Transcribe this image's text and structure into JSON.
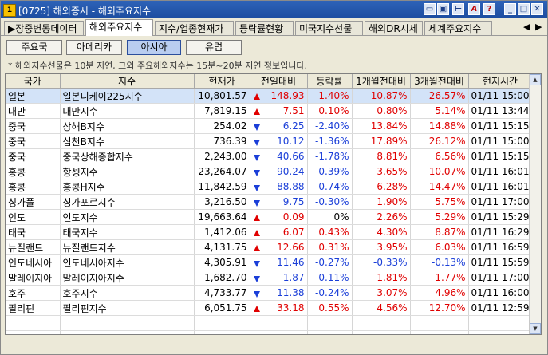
{
  "window": {
    "code": "[0725]",
    "title": "해외증시 - 해외주요지수",
    "app_icon": "1",
    "buttons": [
      "window-icon",
      "window2-icon",
      "pin-icon",
      "font-icon",
      "help-icon",
      "minimize-icon",
      "maximize-icon",
      "close-icon"
    ],
    "help_label": "?",
    "font_label": "A"
  },
  "tabs": [
    {
      "label": "▶장중변동데이터",
      "active": false
    },
    {
      "label": "해외주요지수",
      "active": true
    },
    {
      "label": "지수/업종현재가",
      "active": false
    },
    {
      "label": "등락률현황",
      "active": false
    },
    {
      "label": "미국지수선물",
      "active": false
    },
    {
      "label": "해외DR시세",
      "active": false
    },
    {
      "label": "세계주요지수",
      "active": false
    }
  ],
  "tab_arrows": {
    "left": "◀",
    "right": "▶"
  },
  "regions": [
    {
      "label": "주요국",
      "selected": false
    },
    {
      "label": "아메리카",
      "selected": false
    },
    {
      "label": "아시아",
      "selected": true
    },
    {
      "label": "유럽",
      "selected": false
    }
  ],
  "notice": "* 해외지수선물은 10분 지연, 그외 주요해외지수는 15분~20분 지연 정보입니다.",
  "table": {
    "headers": [
      "국가",
      "지수",
      "현재가",
      "전일대비",
      "등락률",
      "1개월전대비",
      "3개월전대비",
      "현지시간"
    ],
    "rows": [
      {
        "country": "일본",
        "index": "일본니케이225지수",
        "price": "10,801.57",
        "dir": "up",
        "change": "148.93",
        "rate": "1.40%",
        "m1": "10.87%",
        "m3": "26.57%",
        "time": "01/11  15:00"
      },
      {
        "country": "대만",
        "index": "대만지수",
        "price": "7,819.15",
        "dir": "up",
        "change": "7.51",
        "rate": "0.10%",
        "m1": "0.80%",
        "m3": "5.14%",
        "time": "01/11  13:44"
      },
      {
        "country": "중국",
        "index": "상해B지수",
        "price": "254.02",
        "dir": "down",
        "change": "6.25",
        "rate": "-2.40%",
        "m1": "13.84%",
        "m3": "14.88%",
        "time": "01/11  15:15"
      },
      {
        "country": "중국",
        "index": "심천B지수",
        "price": "736.39",
        "dir": "down",
        "change": "10.12",
        "rate": "-1.36%",
        "m1": "17.89%",
        "m3": "26.12%",
        "time": "01/11  15:00"
      },
      {
        "country": "중국",
        "index": "중국상해종합지수",
        "price": "2,243.00",
        "dir": "down",
        "change": "40.66",
        "rate": "-1.78%",
        "m1": "8.81%",
        "m3": "6.56%",
        "time": "01/11  15:15"
      },
      {
        "country": "홍콩",
        "index": "항셍지수",
        "price": "23,264.07",
        "dir": "down",
        "change": "90.24",
        "rate": "-0.39%",
        "m1": "3.65%",
        "m3": "10.07%",
        "time": "01/11  16:01"
      },
      {
        "country": "홍콩",
        "index": "홍콩H지수",
        "price": "11,842.59",
        "dir": "down",
        "change": "88.88",
        "rate": "-0.74%",
        "m1": "6.28%",
        "m3": "14.47%",
        "time": "01/11  16:01"
      },
      {
        "country": "싱가폴",
        "index": "싱가포르지수",
        "price": "3,216.50",
        "dir": "down",
        "change": "9.75",
        "rate": "-0.30%",
        "m1": "1.90%",
        "m3": "5.75%",
        "time": "01/11  17:00"
      },
      {
        "country": "인도",
        "index": "인도지수",
        "price": "19,663.64",
        "dir": "up",
        "change": "0.09",
        "rate": "0%",
        "m1": "2.26%",
        "m3": "5.29%",
        "time": "01/11  15:29"
      },
      {
        "country": "태국",
        "index": "태국지수",
        "price": "1,412.06",
        "dir": "up",
        "change": "6.07",
        "rate": "0.43%",
        "m1": "4.30%",
        "m3": "8.87%",
        "time": "01/11  16:29"
      },
      {
        "country": "뉴질랜드",
        "index": "뉴질랜드지수",
        "price": "4,131.75",
        "dir": "up",
        "change": "12.66",
        "rate": "0.31%",
        "m1": "3.95%",
        "m3": "6.03%",
        "time": "01/11  16:59"
      },
      {
        "country": "인도네시아",
        "index": "인도네시아지수",
        "price": "4,305.91",
        "dir": "down",
        "change": "11.46",
        "rate": "-0.27%",
        "m1": "-0.33%",
        "m3": "-0.13%",
        "time": "01/11  15:59"
      },
      {
        "country": "말레이지아",
        "index": "말레이지아지수",
        "price": "1,682.70",
        "dir": "down",
        "change": "1.87",
        "rate": "-0.11%",
        "m1": "1.81%",
        "m3": "1.77%",
        "time": "01/11  17:00"
      },
      {
        "country": "호주",
        "index": "호주지수",
        "price": "4,733.77",
        "dir": "down",
        "change": "11.38",
        "rate": "-0.24%",
        "m1": "3.07%",
        "m3": "4.96%",
        "time": "01/11  16:00"
      },
      {
        "country": "필리핀",
        "index": "필리핀지수",
        "price": "6,051.75",
        "dir": "up",
        "change": "33.18",
        "rate": "0.55%",
        "m1": "4.56%",
        "m3": "12.70%",
        "time": "01/11  12:59"
      }
    ]
  },
  "scroll_arrows": {
    "up": "▲",
    "down": "▼"
  },
  "colors": {
    "up": "#e00000",
    "down": "#1b3fd8",
    "selected_row": "#d3e3f8",
    "selected_button": "#b9cdf0"
  }
}
